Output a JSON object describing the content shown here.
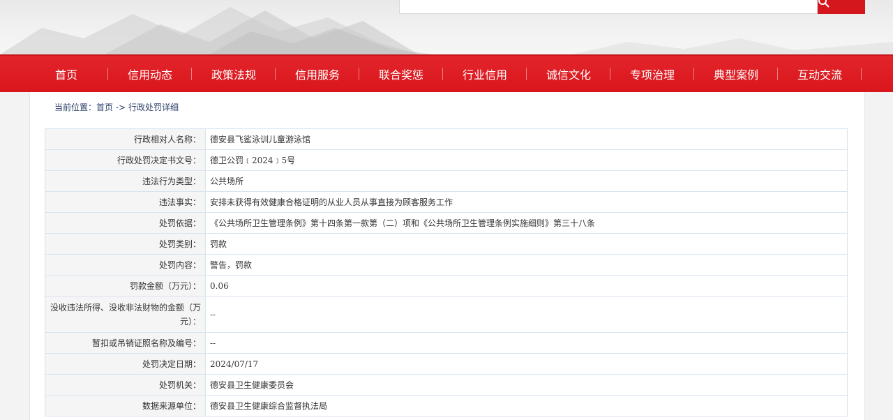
{
  "header": {
    "search_placeholder": ""
  },
  "nav": {
    "items": [
      "首页",
      "信用动态",
      "政策法规",
      "信用服务",
      "联合奖惩",
      "行业信用",
      "诚信文化",
      "专项治理",
      "典型案例",
      "互动交流"
    ]
  },
  "breadcrumb": {
    "prefix": "当前位置：",
    "home": "首页",
    "sep": " -> ",
    "current": "行政处罚详细"
  },
  "detail": {
    "rows": [
      {
        "label": "行政相对人名称：",
        "value": "德安县飞鲨泳训儿童游泳馆"
      },
      {
        "label": "行政处罚决定书文号：",
        "value": "德卫公罚﹝2024﹞5号"
      },
      {
        "label": "违法行为类型：",
        "value": "公共场所"
      },
      {
        "label": "违法事实：",
        "value": "安排未获得有效健康合格证明的从业人员从事直接为顾客服务工作"
      },
      {
        "label": "处罚依据：",
        "value": "《公共场所卫生管理条例》第十四条第一款第（二）项和《公共场所卫生管理条例实施细则》第三十八条"
      },
      {
        "label": "处罚类别：",
        "value": "罚款"
      },
      {
        "label": "处罚内容：",
        "value": "警告，罚款"
      },
      {
        "label": "罚款金额（万元）：",
        "value": "0.06"
      },
      {
        "label": "没收违法所得、没收非法财物的金额（万元）：",
        "value": "--"
      },
      {
        "label": "暂扣或吊销证照名称及编号：",
        "value": "--"
      },
      {
        "label": "处罚决定日期：",
        "value": "2024/07/17"
      },
      {
        "label": "处罚机关：",
        "value": "德安县卫生健康委员会"
      },
      {
        "label": "数据来源单位：",
        "value": "德安县卫生健康综合监督执法局"
      }
    ]
  },
  "colors": {
    "nav_red": "#d9161c",
    "breadcrumb_text": "#2b3f66",
    "table_border": "#d8e4ef"
  }
}
